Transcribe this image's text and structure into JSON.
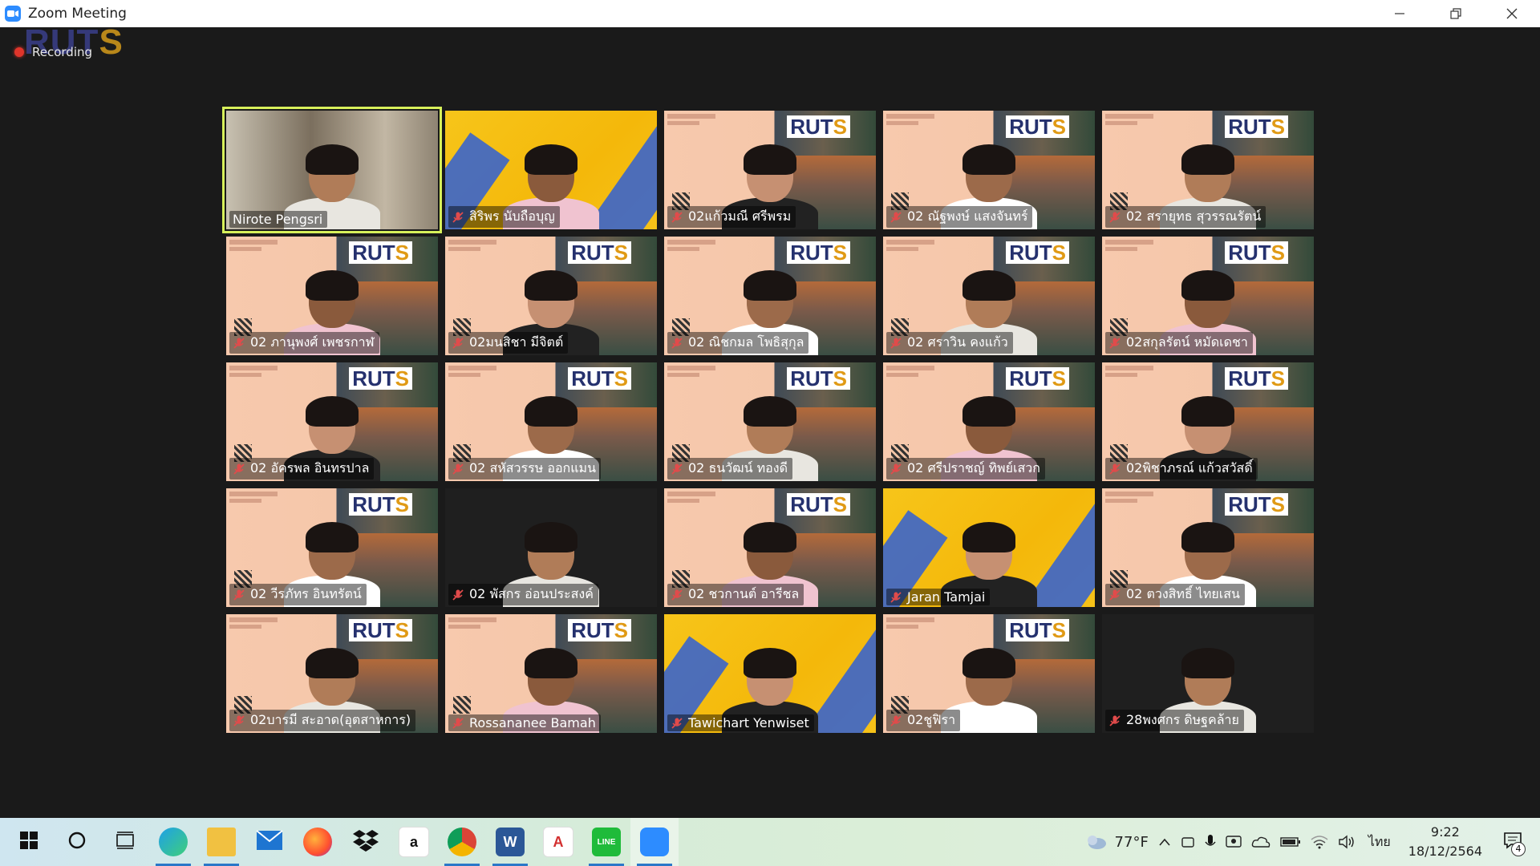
{
  "window": {
    "title": "Zoom Meeting"
  },
  "recording": {
    "label": "Recording"
  },
  "watermark": {
    "brand_left": "RUT",
    "brand_right": "S"
  },
  "backgrounds": {
    "logo_main": "RUT",
    "logo_accent": "S"
  },
  "participants": [
    {
      "name": "Nirote  Pengsri",
      "muted": false,
      "active": true,
      "bg": "camera"
    },
    {
      "name": "สิริพร นับถือบุญ",
      "muted": true,
      "active": false,
      "bg": "yellow"
    },
    {
      "name": "02แก้วมณี ศรีพรม",
      "muted": true,
      "active": false,
      "bg": "virtual"
    },
    {
      "name": "02 ณัฐพงษ์ แสงจันทร์",
      "muted": true,
      "active": false,
      "bg": "virtual"
    },
    {
      "name": "02 สรายุทธ สุวรรณรัตน์",
      "muted": true,
      "active": false,
      "bg": "virtual"
    },
    {
      "name": "02 ภานุพงศ์ เพชรกาฬ",
      "muted": true,
      "active": false,
      "bg": "virtual"
    },
    {
      "name": "02มนสิชา มีจิตต์",
      "muted": true,
      "active": false,
      "bg": "virtual"
    },
    {
      "name": "02 ณิชกมล โพธิสุกุล",
      "muted": true,
      "active": false,
      "bg": "virtual"
    },
    {
      "name": "02 ศราวิน คงแก้ว",
      "muted": true,
      "active": false,
      "bg": "virtual"
    },
    {
      "name": "02สกุลรัตน์ หมัดเดชา",
      "muted": true,
      "active": false,
      "bg": "virtual"
    },
    {
      "name": "02 อัครพล อินทรปาล",
      "muted": true,
      "active": false,
      "bg": "virtual"
    },
    {
      "name": "02 สหัสวรรษ ออกแมน",
      "muted": true,
      "active": false,
      "bg": "virtual"
    },
    {
      "name": "02 ธนวัฒน์ ทองดี",
      "muted": true,
      "active": false,
      "bg": "virtual"
    },
    {
      "name": "02 ศรีปราชญ์ ทิพย์เสวก",
      "muted": true,
      "active": false,
      "bg": "virtual"
    },
    {
      "name": "02พิชาภรณ์ แก้วสวัสดิ์",
      "muted": true,
      "active": false,
      "bg": "virtual"
    },
    {
      "name": "02 วีรภัทร อินทรัตน์",
      "muted": true,
      "active": false,
      "bg": "virtual"
    },
    {
      "name": "02 พัสกร อ่อนประสงค์",
      "muted": true,
      "active": false,
      "bg": "dark"
    },
    {
      "name": "02 ชวกานต์ อารีชล",
      "muted": true,
      "active": false,
      "bg": "virtual"
    },
    {
      "name": "Jaran Tamjai",
      "muted": true,
      "active": false,
      "bg": "yellow"
    },
    {
      "name": "02 ตวงสิทธิ์ ไทยเสน",
      "muted": true,
      "active": false,
      "bg": "virtual"
    },
    {
      "name": "02บารมี สะอาด(อุตสาหการ)",
      "muted": true,
      "active": false,
      "bg": "virtual"
    },
    {
      "name": "Rossananee Bamah",
      "muted": true,
      "active": false,
      "bg": "virtual"
    },
    {
      "name": "Tawichart Yenwiset",
      "muted": true,
      "active": false,
      "bg": "yellow"
    },
    {
      "name": "02ชูฟิรา",
      "muted": true,
      "active": false,
      "bg": "virtual"
    },
    {
      "name": "28พงศกร ดิษฐคล้าย",
      "muted": true,
      "active": false,
      "bg": "dark"
    }
  ],
  "taskbar": {
    "apps": [
      {
        "icon": "windows-start-icon"
      },
      {
        "icon": "search-circle-icon"
      },
      {
        "icon": "task-view-icon"
      },
      {
        "icon": "edge-icon"
      },
      {
        "icon": "file-explorer-icon"
      },
      {
        "icon": "mail-icon"
      },
      {
        "icon": "firefox-icon"
      },
      {
        "icon": "dropbox-icon"
      },
      {
        "icon": "amazon-icon"
      },
      {
        "icon": "chrome-icon"
      },
      {
        "icon": "word-icon",
        "label": "W"
      },
      {
        "icon": "acrobat-icon"
      },
      {
        "icon": "line-icon",
        "label": "LINE"
      },
      {
        "icon": "zoom-icon"
      }
    ],
    "weather": "77°F",
    "language": "ไทย",
    "time": "9:22",
    "date": "18/12/2564",
    "notification_count": "4"
  }
}
